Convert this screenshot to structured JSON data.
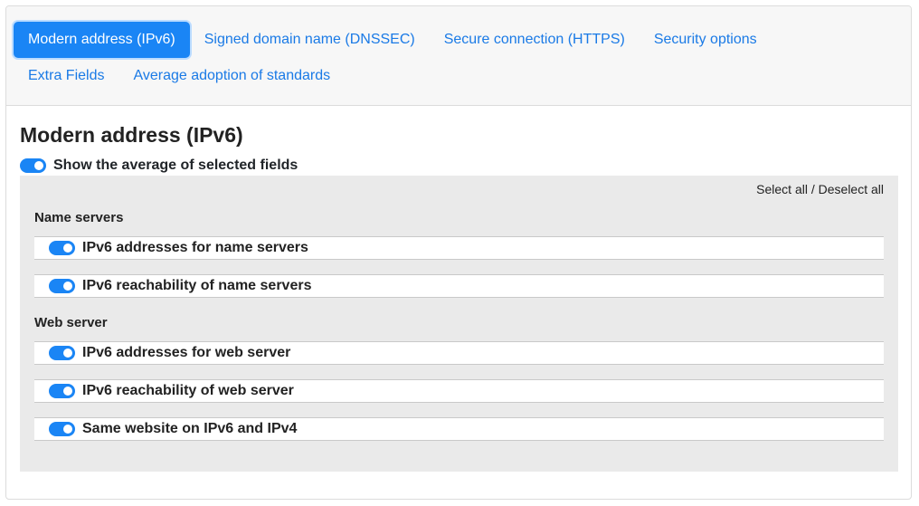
{
  "tabs": {
    "row1": [
      "Modern address (IPv6)",
      "Signed domain name (DNSSEC)",
      "Secure connection (HTTPS)",
      "Security options"
    ],
    "row2": [
      "Extra Fields",
      "Average adoption of standards"
    ],
    "active": "Modern address (IPv6)"
  },
  "section": {
    "title": "Modern address (IPv6)",
    "average_toggle_label": "Show the average of selected fields",
    "average_toggle_on": true
  },
  "panel": {
    "select_links": "Select all / Deselect all",
    "groups": [
      {
        "title": "Name servers",
        "fields": [
          {
            "label": "IPv6 addresses for name servers",
            "on": true
          },
          {
            "label": "IPv6 reachability of name servers",
            "on": true
          }
        ]
      },
      {
        "title": "Web server",
        "fields": [
          {
            "label": "IPv6 addresses for web server",
            "on": true
          },
          {
            "label": "IPv6 reachability of web server",
            "on": true
          },
          {
            "label": "Same website on IPv6 and IPv4",
            "on": true
          }
        ]
      }
    ]
  },
  "colors": {
    "accent": "#1a85f5",
    "link": "#1a7ae6",
    "panel_bg": "#eaeaea"
  }
}
